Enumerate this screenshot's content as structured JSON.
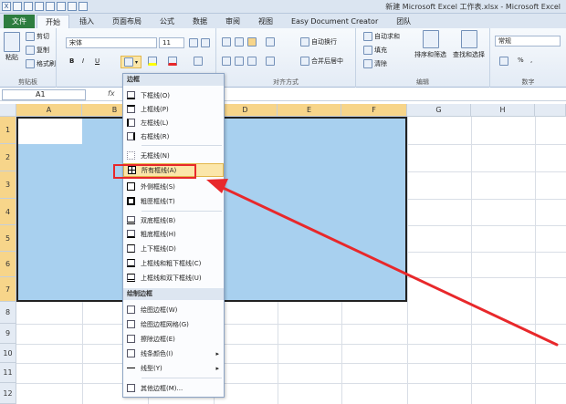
{
  "window": {
    "title": "新建 Microsoft Excel 工作表.xlsx - Microsoft Excel"
  },
  "tabs": [
    "文件",
    "开始",
    "插入",
    "页面布局",
    "公式",
    "数据",
    "审阅",
    "视图",
    "Easy Document Creator",
    "团队"
  ],
  "clipboard": {
    "paste": "粘贴",
    "cut": "剪切",
    "copy": "复制",
    "format_painter": "格式刷",
    "label": "剪贴板"
  },
  "font": {
    "name": "宋体",
    "size": "11",
    "bold": "B",
    "italic": "I",
    "underline": "U"
  },
  "alignment": {
    "wrap": "自动换行",
    "merge": "合并后居中",
    "label": "对齐方式"
  },
  "number": {
    "format": "常规",
    "percent": "%",
    "comma": ",",
    "label": "数字"
  },
  "editing": {
    "autosum": "自动求和",
    "fill": "填充",
    "clear": "清除",
    "sort": "排序和筛选",
    "find": "查找和选择",
    "label": "编辑"
  },
  "formula_bar": {
    "cell_ref": "A1",
    "fx": "fx"
  },
  "columns": [
    "A",
    "B",
    "C",
    "D",
    "E",
    "F",
    "G",
    "H"
  ],
  "rows": [
    "1",
    "2",
    "3",
    "4",
    "5",
    "6",
    "7",
    "8",
    "9",
    "10",
    "11",
    "12"
  ],
  "border_menu": {
    "header_borders": "边框",
    "header_draw": "绘制边框",
    "items": [
      "下框线(O)",
      "上框线(P)",
      "左框线(L)",
      "右框线(R)",
      "无框线(N)",
      "所有框线(A)",
      "外侧框线(S)",
      "粗匣框线(T)",
      "双底框线(B)",
      "粗底框线(H)",
      "上下框线(D)",
      "上框线和粗下框线(C)",
      "上框线和双下框线(U)"
    ],
    "draw_items": [
      "绘图边框(W)",
      "绘图边框网格(G)",
      "擦除边框(E)",
      "线条颜色(I)",
      "线型(Y)",
      "其他边框(M)..."
    ]
  },
  "colors": {
    "selection": "#a8d0ef",
    "highlight": "#fbe6a9",
    "annotation": "#e8282b",
    "file_tab": "#2d7d3f"
  }
}
